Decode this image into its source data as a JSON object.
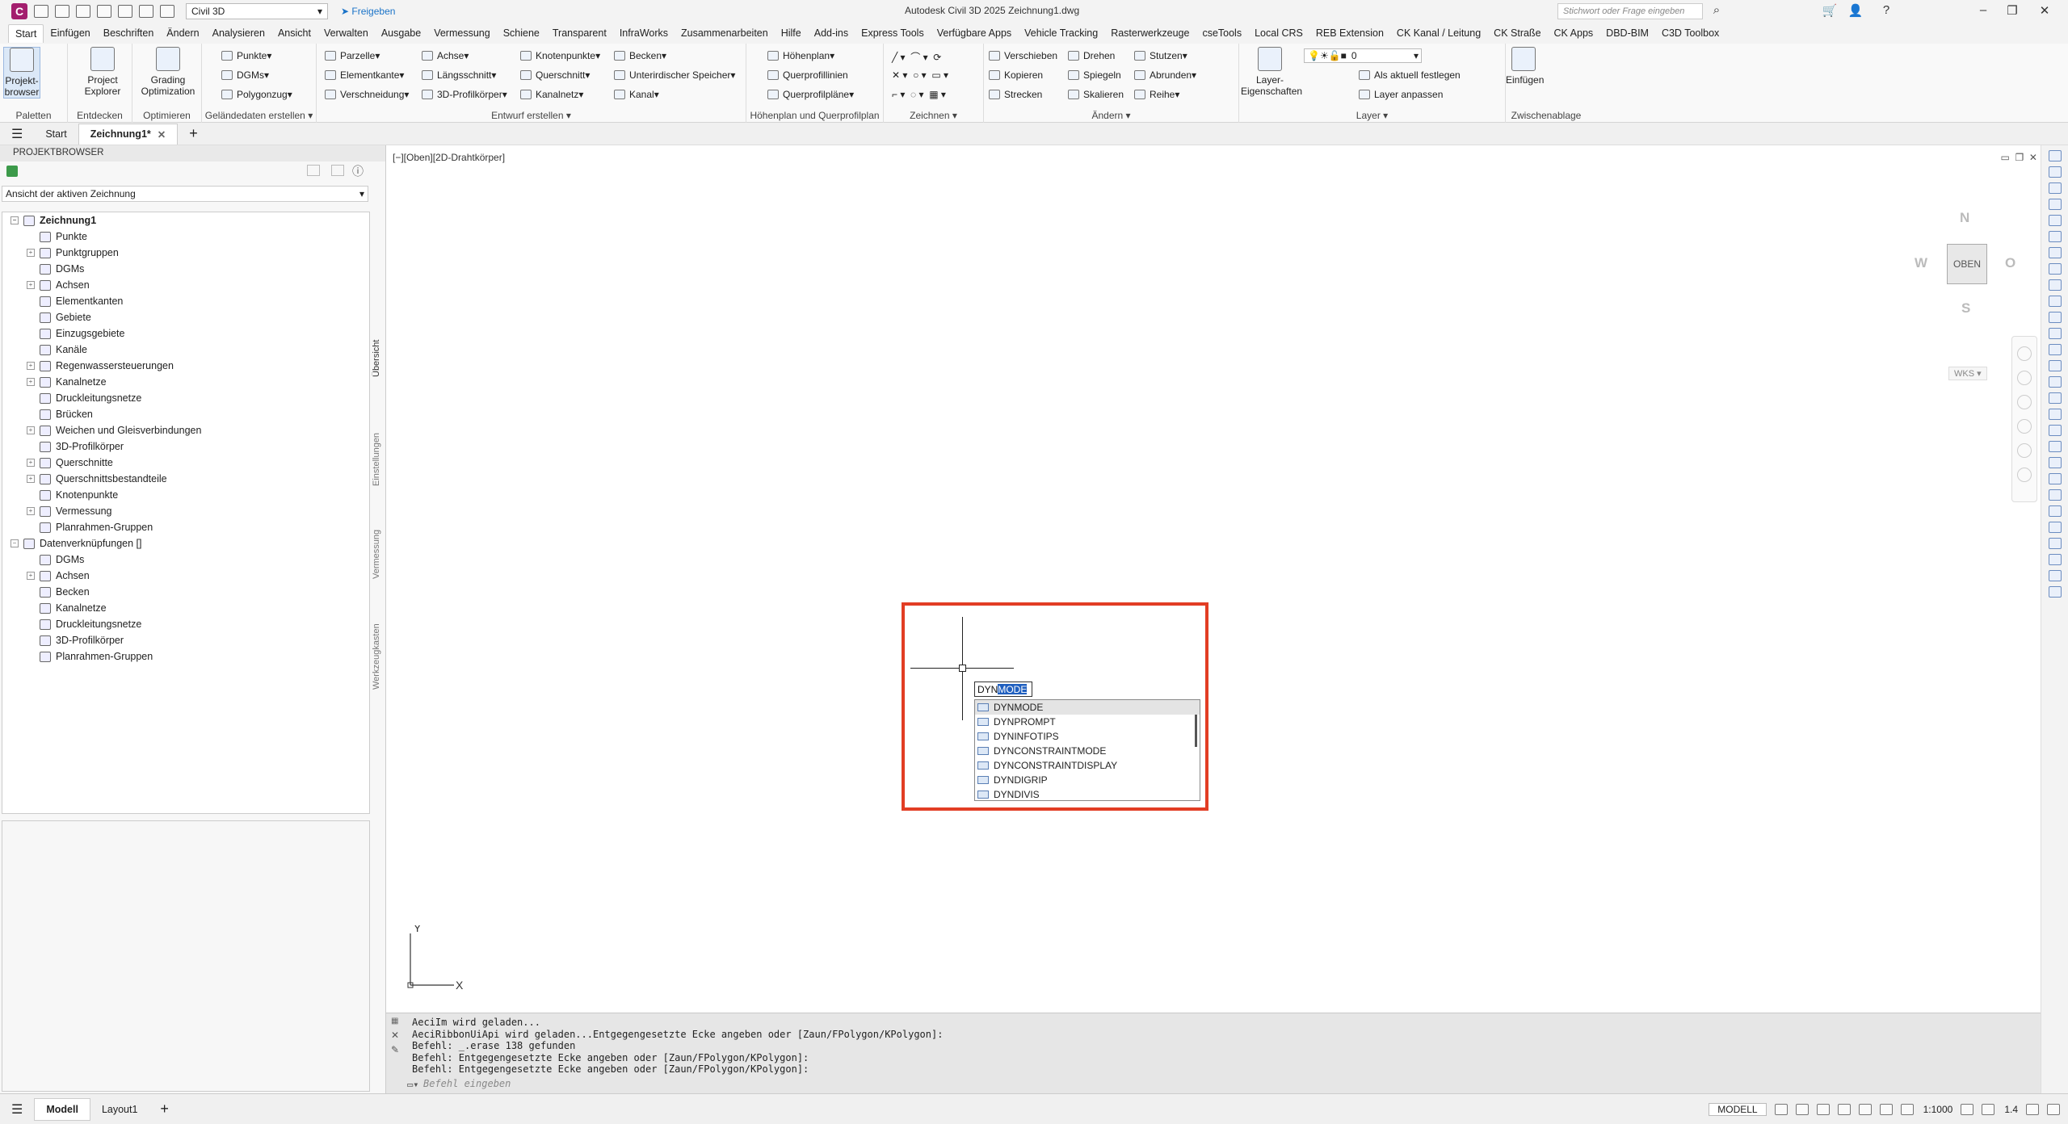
{
  "titlebar": {
    "app_letter": "C",
    "workspace": "Civil 3D",
    "share_label": "Freigeben",
    "window_title": "Autodesk Civil 3D 2025 Zeichnung1.dwg",
    "search_placeholder": "Stichwort oder Frage eingeben"
  },
  "menubar": {
    "tabs": [
      "Start",
      "Einfügen",
      "Beschriften",
      "Ändern",
      "Analysieren",
      "Ansicht",
      "Verwalten",
      "Ausgabe",
      "Vermessung",
      "Schiene",
      "Transparent",
      "InfraWorks",
      "Zusammenarbeiten",
      "Hilfe",
      "Add-ins",
      "Express Tools",
      "Verfügbare Apps",
      "Vehicle Tracking",
      "Rasterwerkzeuge",
      "cseTools",
      "Local CRS",
      "REB Extension",
      "CK Kanal / Leitung",
      "CK Straße",
      "CK Apps",
      "DBD-BIM",
      "C3D Toolbox"
    ]
  },
  "ribbon": {
    "paletten": {
      "title": "Paletten",
      "big": "Projekt-\nbrowser"
    },
    "entdecken": {
      "title": "Entdecken",
      "big": "Project\nExplorer"
    },
    "optimieren": {
      "title": "Optimieren",
      "big": "Grading\nOptimization"
    },
    "gelaende": {
      "title": "Geländedaten erstellen",
      "items": [
        "Punkte",
        "DGMs",
        "Polygonzug"
      ]
    },
    "entwurf": {
      "title": "Entwurf erstellen",
      "items": [
        "Parzelle",
        "Achse",
        "Knotenpunkte",
        "Becken",
        "Elementkante",
        "Längsschnitt",
        "Querschnitt",
        "Unterirdischer Speicher",
        "Verschneidung",
        "3D-Profilkörper",
        "Kanalnetz",
        "Kanal"
      ]
    },
    "hoehenplan": {
      "title": "Höhenplan und Querprofilplan",
      "items": [
        "Höhenplan",
        "Querprofillinien",
        "Querprofilpläne"
      ]
    },
    "zeichnen": {
      "title": "Zeichnen"
    },
    "aendern": {
      "title": "Ändern",
      "items": [
        "Verschieben",
        "Drehen",
        "Stutzen",
        "Kopieren",
        "Spiegeln",
        "Abrunden",
        "Strecken",
        "Skalieren",
        "Reihe"
      ]
    },
    "layer": {
      "title": "Layer",
      "big": "Layer-\nEigenschaften",
      "layer_value": "0",
      "items": [
        "Als aktuell festlegen",
        "Layer anpassen"
      ]
    },
    "zwischenablage": {
      "title": "Zwischenablage",
      "big": "Einfügen"
    }
  },
  "doctabs": {
    "start": "Start",
    "drawing": "Zeichnung1*"
  },
  "projectbrowser": {
    "header": "PROJEKTBROWSER",
    "view_select": "Ansicht der aktiven Zeichnung",
    "vertical_tabs": [
      "Übersicht",
      "Einstellungen",
      "Vermessung",
      "Werkzeugkasten"
    ],
    "tree": [
      {
        "label": "Zeichnung1",
        "level": 0,
        "toggle": "−",
        "bold": true
      },
      {
        "label": "Punkte",
        "level": 1,
        "toggle": ""
      },
      {
        "label": "Punktgruppen",
        "level": 1,
        "toggle": "+"
      },
      {
        "label": "DGMs",
        "level": 1,
        "toggle": ""
      },
      {
        "label": "Achsen",
        "level": 1,
        "toggle": "+"
      },
      {
        "label": "Elementkanten",
        "level": 1,
        "toggle": ""
      },
      {
        "label": "Gebiete",
        "level": 1,
        "toggle": ""
      },
      {
        "label": "Einzugsgebiete",
        "level": 1,
        "toggle": ""
      },
      {
        "label": "Kanäle",
        "level": 1,
        "toggle": ""
      },
      {
        "label": "Regenwassersteuerungen",
        "level": 1,
        "toggle": "+"
      },
      {
        "label": "Kanalnetze",
        "level": 1,
        "toggle": "+"
      },
      {
        "label": "Druckleitungsnetze",
        "level": 1,
        "toggle": ""
      },
      {
        "label": "Brücken",
        "level": 1,
        "toggle": ""
      },
      {
        "label": "Weichen und Gleisverbindungen",
        "level": 1,
        "toggle": "+"
      },
      {
        "label": "3D-Profilkörper",
        "level": 1,
        "toggle": ""
      },
      {
        "label": "Querschnitte",
        "level": 1,
        "toggle": "+"
      },
      {
        "label": "Querschnittsbestandteile",
        "level": 1,
        "toggle": "+"
      },
      {
        "label": "Knotenpunkte",
        "level": 1,
        "toggle": ""
      },
      {
        "label": "Vermessung",
        "level": 1,
        "toggle": "+"
      },
      {
        "label": "Planrahmen-Gruppen",
        "level": 1,
        "toggle": ""
      },
      {
        "label": "Datenverknüpfungen []",
        "level": 0,
        "toggle": "−"
      },
      {
        "label": "DGMs",
        "level": 1,
        "toggle": ""
      },
      {
        "label": "Achsen",
        "level": 1,
        "toggle": "+"
      },
      {
        "label": "Becken",
        "level": 1,
        "toggle": ""
      },
      {
        "label": "Kanalnetze",
        "level": 1,
        "toggle": ""
      },
      {
        "label": "Druckleitungsnetze",
        "level": 1,
        "toggle": ""
      },
      {
        "label": "3D-Profilkörper",
        "level": 1,
        "toggle": ""
      },
      {
        "label": "Planrahmen-Gruppen",
        "level": 1,
        "toggle": ""
      }
    ]
  },
  "viewport": {
    "label": "[−][Oben][2D-Drahtkörper]",
    "navcube": {
      "north": "N",
      "south": "S",
      "west": "W",
      "east": "O",
      "top": "OBEN",
      "wcs": "WKS"
    },
    "ucs": {
      "x": "X",
      "y": "Y"
    },
    "dyn_input": {
      "typed": "DYN",
      "selected": "MODE"
    },
    "autocomplete": [
      "DYNMODE",
      "DYNPROMPT",
      "DYNINFOTIPS",
      "DYNCONSTRAINTMODE",
      "DYNCONSTRAINTDISPLAY",
      "DYNDIGRIP",
      "DYNDIVIS"
    ],
    "highlight_color": "#e23d24"
  },
  "commandline": {
    "history": [
      "AeciIm wird geladen...",
      "AeciRibbonUiApi wird geladen...Entgegengesetzte Ecke angeben oder [Zaun/FPolygon/KPolygon]:",
      "Befehl: _.erase 138 gefunden",
      "Befehl: Entgegengesetzte Ecke angeben oder [Zaun/FPolygon/KPolygon]:",
      "Befehl: Entgegengesetzte Ecke angeben oder [Zaun/FPolygon/KPolygon]:"
    ],
    "placeholder": "Befehl eingeben"
  },
  "statusbar": {
    "model_tab": "Modell",
    "layout_tab": "Layout1",
    "mode": "MODELL",
    "scale": "1:1000",
    "zoom": "1.4"
  }
}
